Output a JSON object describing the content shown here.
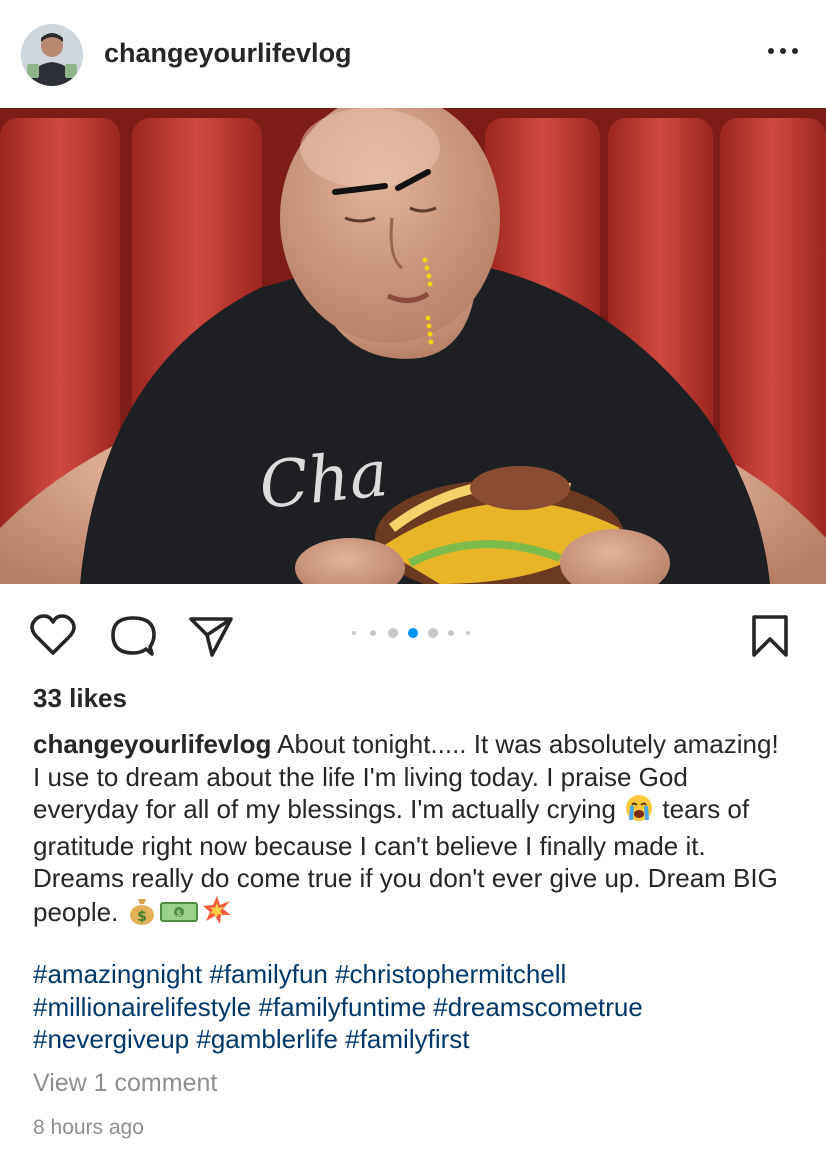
{
  "post": {
    "username": "changeyourlifevlog",
    "more_label": "•••",
    "image_alt": "Man in black t-shirt eating a large burger in a red diner booth",
    "shirt_text": "Cha",
    "carousel": {
      "count": 7,
      "active_index": 3
    },
    "likes": "33 likes",
    "caption": {
      "username": "changeyourlifevlog",
      "part1": " About tonight..... It was absolutely amazing! I use to dream about the life I'm living today. I praise God everyday for all of my blessings. I'm actually crying ",
      "emoji_crying": "😭",
      "part2": " tears of gratitude right now because I can't believe I finally made it. Dreams really do come true if you don't ever give up. Dream BIG people. ",
      "emoji_moneybag": "💰",
      "emoji_dollar": "💵",
      "emoji_collision": "💥"
    },
    "hashtags": [
      "#amazingnight",
      "#familyfun",
      "#christophermitchell",
      "#millionairelifestyle",
      "#familyfuntime",
      "#dreamscometrue",
      "#nevergiveup",
      "#gamblerlife",
      "#familyfirst"
    ],
    "view_comments": "View 1 comment",
    "timestamp": "8 hours ago"
  },
  "colors": {
    "booth_red": "#b8322c",
    "shirt": "#1e1f22",
    "hashtag": "#00376b",
    "carousel_active": "#0095f6",
    "muted": "#8e8e8e"
  }
}
